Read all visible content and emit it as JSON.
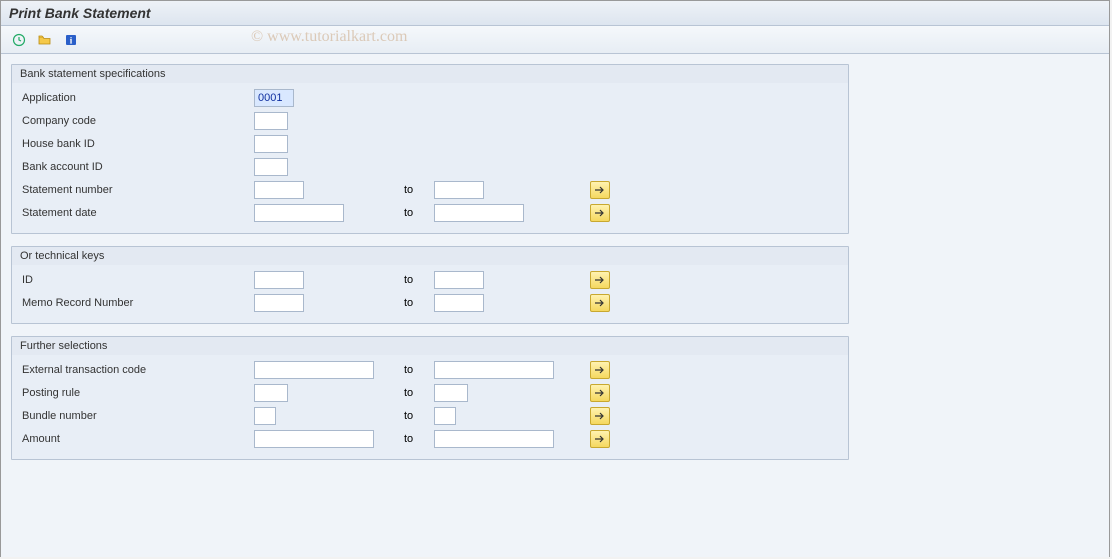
{
  "title": "Print Bank Statement",
  "watermark": "© www.tutorialkart.com",
  "groups": {
    "spec": {
      "title": "Bank statement specifications",
      "application_label": "Application",
      "application_value": "0001",
      "company_code_label": "Company code",
      "company_code_value": "",
      "house_bank_label": "House bank ID",
      "house_bank_value": "",
      "bank_account_label": "Bank account ID",
      "bank_account_value": "",
      "statement_number_label": "Statement number",
      "statement_number_from": "",
      "statement_number_to": "",
      "statement_date_label": "Statement date",
      "statement_date_from": "",
      "statement_date_to": ""
    },
    "tech": {
      "title": "Or technical keys",
      "id_label": "ID",
      "id_from": "",
      "id_to": "",
      "memo_label": "Memo Record Number",
      "memo_from": "",
      "memo_to": ""
    },
    "further": {
      "title": "Further selections",
      "ext_trans_label": "External transaction code",
      "ext_trans_from": "",
      "ext_trans_to": "",
      "posting_rule_label": "Posting rule",
      "posting_rule_from": "",
      "posting_rule_to": "",
      "bundle_label": "Bundle number",
      "bundle_from": "",
      "bundle_to": "",
      "amount_label": "Amount",
      "amount_from": "",
      "amount_to": ""
    }
  },
  "to_text": "to"
}
